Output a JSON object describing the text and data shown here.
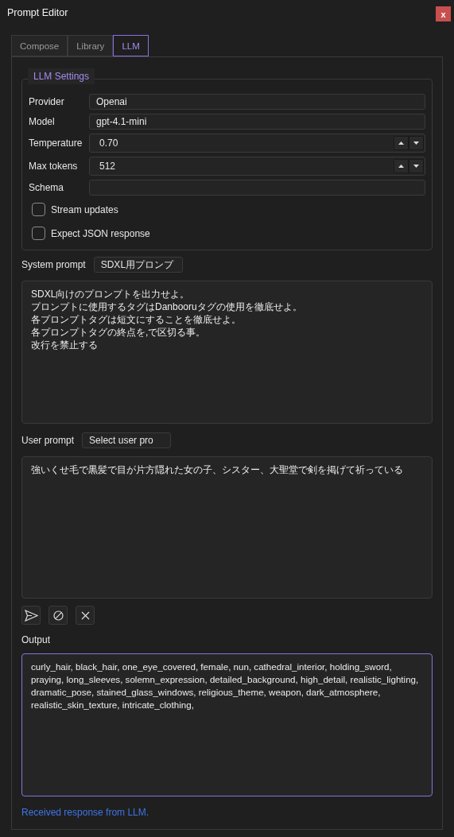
{
  "window": {
    "title": "Prompt Editor",
    "close": "x"
  },
  "tabs": [
    {
      "label": "Compose",
      "selected": false
    },
    {
      "label": "Library",
      "selected": false
    },
    {
      "label": "LLM",
      "selected": true
    }
  ],
  "settings": {
    "title": "LLM Settings",
    "fields": [
      {
        "kind": "text",
        "label": "Provider",
        "value": "Openai"
      },
      {
        "kind": "text",
        "label": "Model",
        "value": "gpt-4.1-mini"
      },
      {
        "kind": "spin",
        "label": "Temperature",
        "value": "0.70"
      },
      {
        "kind": "spin",
        "label": "Max tokens",
        "value": "512"
      },
      {
        "kind": "text",
        "label": "Schema"
      }
    ],
    "checkboxes": [
      {
        "label": "Stream updates",
        "checked": false
      },
      {
        "label": "Expect JSON response",
        "checked": false
      }
    ]
  },
  "system_prompt": {
    "label": "System prompt",
    "preset": "SDXL用プロンプ",
    "lines": [
      "SDXL向けのプロンプトを出力せよ。",
      "プロンプトに使用するタグはDanbooruタグの使用を徹底せよ。",
      "各プロンプトタグは短文にすることを徹底せよ。",
      "各プロンプトタグの終点を,で区切る事。",
      "改行を禁止する"
    ]
  },
  "user_prompt": {
    "label": "User prompt",
    "preset": "Select user pro",
    "text": "強いくせ毛で黒髪で目が片方隠れた女の子、シスター、大聖堂で剣を掲げて祈っている"
  },
  "actions": [
    {
      "kind": "send"
    },
    {
      "kind": "cancel"
    },
    {
      "kind": "clear"
    }
  ],
  "output": {
    "label": "Output",
    "text": "curly_hair, black_hair, one_eye_covered, female, nun, cathedral_interior, holding_sword, praying, long_sleeves, solemn_expression, detailed_background, high_detail, realistic_lighting, dramatic_pose, stained_glass_windows, religious_theme, weapon, dark_atmosphere, realistic_skin_texture, intricate_clothing,",
    "focused": true
  },
  "status": "Received response from LLM."
}
